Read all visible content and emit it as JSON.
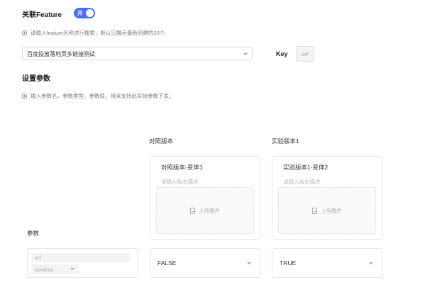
{
  "feature_section": {
    "title": "关联Feature",
    "toggle_label": "开",
    "toggle_on": true,
    "hint": "请输入feature名称进行搜索，默认只展示最新创建的20个",
    "selected_feature": "百度投放落地页多链接测试",
    "key_label": "Key",
    "key_value": "erf"
  },
  "params_section": {
    "title": "设置参数",
    "hint": "输入参数名，参数类型，参数值，用来支持此实验参数下发。",
    "param_column_label": "参数",
    "param": {
      "name_value": "erf",
      "type_value": "boolean"
    },
    "columns": [
      {
        "title": "对照版本",
        "variant_name": "对照版本-变体1",
        "desc_placeholder": "请输入版本描述",
        "upload_label": "上传图片",
        "value": "FALSE"
      },
      {
        "title": "实验版本1",
        "variant_name": "实验版本1-变体2",
        "desc_placeholder": "请输入版本描述",
        "upload_label": "上传图片",
        "value": "TRUE"
      }
    ]
  },
  "colors": {
    "toggle_accent": "#4b6ef7",
    "border": "#e6e6e6",
    "muted_text": "#aaaaaa"
  }
}
